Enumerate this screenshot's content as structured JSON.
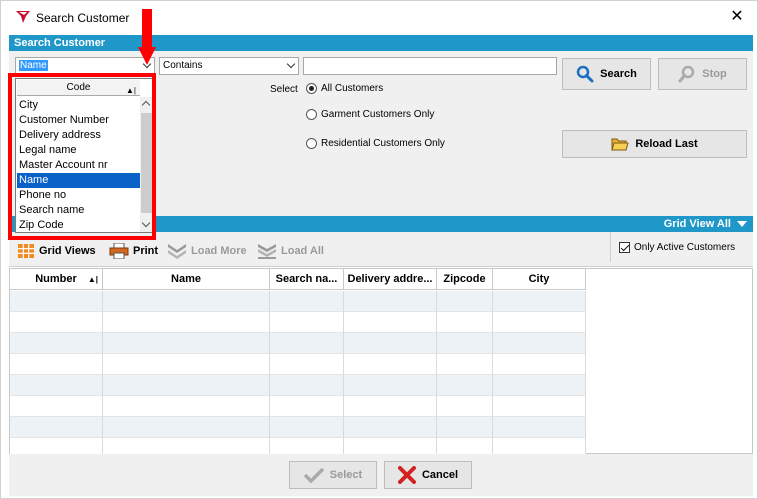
{
  "window": {
    "title": "Search Customer"
  },
  "search_section": {
    "header": "Search Customer",
    "field_combo_value": "Name",
    "operator_combo_value": "Contains",
    "search_text": "",
    "search_button": "Search",
    "stop_button": "Stop",
    "select_label": "Select",
    "radio_options": [
      {
        "label": "All Customers",
        "checked": true
      },
      {
        "label": "Garment Customers Only",
        "checked": false
      },
      {
        "label": "Residential Customers Only",
        "checked": false
      }
    ],
    "reload_button": "Reload Last"
  },
  "field_dropdown": {
    "header": "Code",
    "items": [
      "City",
      "Customer Number",
      "Delivery address",
      "Legal name",
      "Master Account nr",
      "Name",
      "Phone no",
      "Search name",
      "Zip Code"
    ],
    "selected": "Name"
  },
  "grid_section": {
    "grid_view_all": "Grid View All",
    "toolbar": {
      "grid_views": "Grid Views",
      "print": "Print",
      "load_more": "Load More",
      "load_all": "Load All"
    },
    "only_active_label": "Only Active Customers",
    "only_active_checked": true,
    "columns": [
      "Number",
      "Name",
      "Search na...",
      "Delivery addre...",
      "Zipcode",
      "City"
    ]
  },
  "footer": {
    "select_button": "Select",
    "cancel_button": "Cancel"
  },
  "colors": {
    "section_bar": "#1f98c9",
    "highlight": "#ff0000",
    "selection": "#0a62c9"
  }
}
